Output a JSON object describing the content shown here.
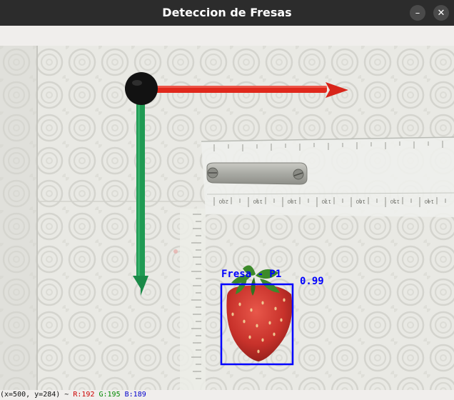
{
  "window": {
    "title": "Deteccion de Fresas",
    "minimize_glyph": "–",
    "close_glyph": "✕"
  },
  "detection": {
    "label": "Fresa - P1",
    "confidence": "0.99",
    "box_color": "#0000ff"
  },
  "axes_marker": {
    "x_axis_color": "#e0281c",
    "y_axis_color": "#1f9a53",
    "origin_color": "#121212"
  },
  "ruler_ticks": [
    "200",
    "190",
    "180",
    "170",
    "160",
    "150",
    "140"
  ],
  "statusbar": {
    "coords": "(x=500, y=284) ~",
    "r": "R:192",
    "g": "G:195",
    "b": "B:189",
    "r_color": "#cc0000",
    "g_color": "#008800",
    "b_color": "#0000cc"
  }
}
